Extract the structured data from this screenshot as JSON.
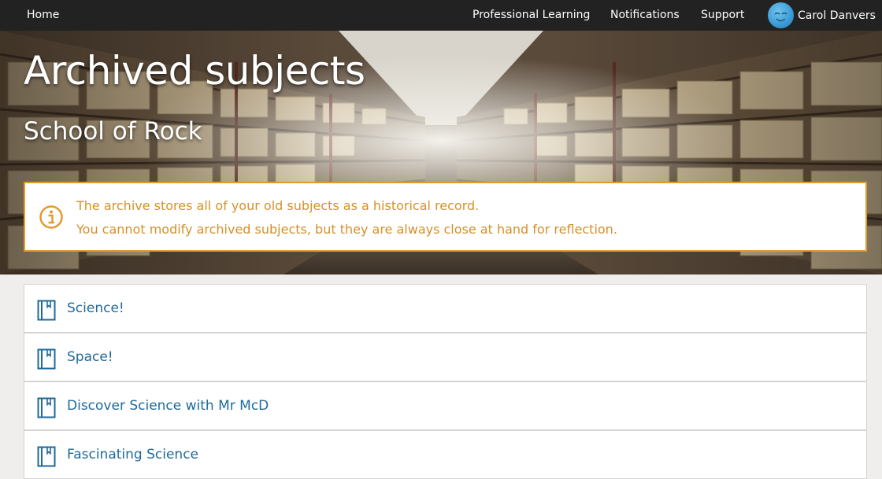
{
  "nav": {
    "home": "Home",
    "links": [
      "Professional Learning",
      "Notifications",
      "Support"
    ],
    "user_name": "Carol Danvers"
  },
  "hero": {
    "title": "Archived subjects",
    "subtitle": "School of Rock"
  },
  "notice": {
    "icon": "info-icon",
    "line1": "The archive stores all of your old subjects as a historical record.",
    "line2": "You cannot modify archived subjects, but they are always close at hand for reflection."
  },
  "subjects": [
    {
      "label": "Science!",
      "icon": "book-icon"
    },
    {
      "label": "Space!",
      "icon": "book-icon"
    },
    {
      "label": "Discover Science with Mr McD",
      "icon": "book-icon"
    },
    {
      "label": "Fascinating Science",
      "icon": "book-icon"
    }
  ],
  "colors": {
    "nav_bg": "#222222",
    "notice_border": "#e29a2d",
    "notice_text": "#d5902a",
    "link": "#1f6a9a",
    "page_bg": "#efeeec"
  }
}
